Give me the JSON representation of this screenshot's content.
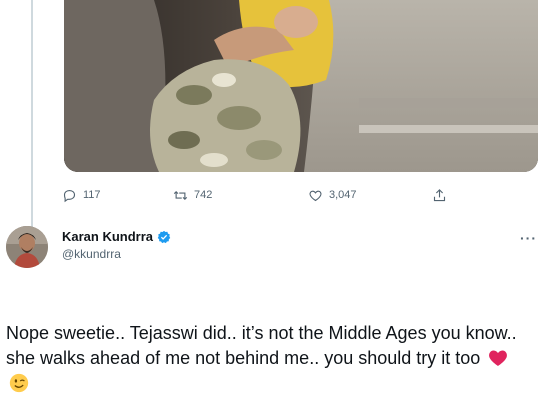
{
  "previous_tweet": {
    "stats": {
      "replies": "117",
      "retweets": "742",
      "likes": "3,047"
    },
    "icons": [
      "reply-icon",
      "retweet-icon",
      "like-icon",
      "share-icon"
    ]
  },
  "reply_tweet": {
    "author_name": "Karan Kundrra",
    "author_handle": "@kkundrra",
    "verified": true,
    "text": "Nope sweetie.. Tejasswi did.. it’s not the Middle Ages you know.. she walks ahead of me not behind me.. you should try it too",
    "trailing_emojis": [
      "red-heart-emoji",
      "winking-face-emoji"
    ]
  },
  "colors": {
    "text": "#0f1419",
    "secondary_text": "#536471",
    "verified_blue": "#1d9bf0",
    "thread_line": "#cfd9de",
    "heart_red": "#e0245e"
  }
}
